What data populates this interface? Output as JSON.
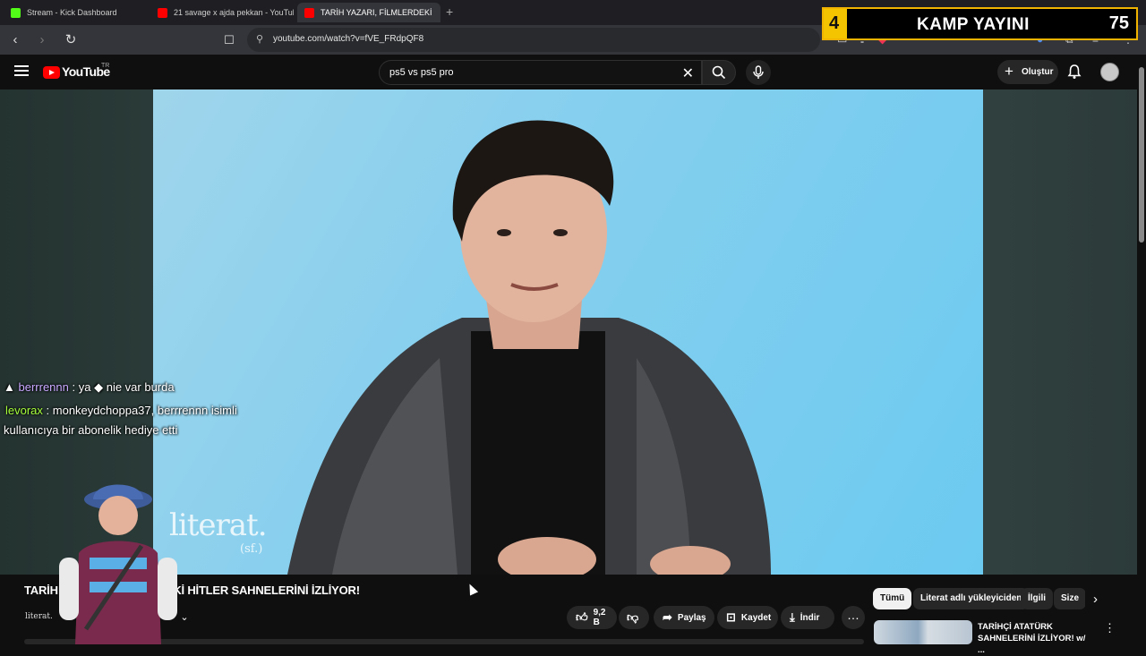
{
  "browser": {
    "tabs": [
      {
        "title": "Stream - Kick Dashboard",
        "favicon_color": "#53fc18"
      },
      {
        "title": "21 savage x ajda pekkan - YouTube",
        "favicon_color": "#ff0000"
      },
      {
        "title": "TARİH YAZARI, FİLMLERDEKİ",
        "favicon_color": "#ff0000",
        "active": true
      }
    ],
    "new_tab": "+",
    "url": "youtube.com/watch?v=fVE_FRdpQF8"
  },
  "overlay": {
    "number": "4",
    "title": "KAMP YAYINI",
    "count": "75"
  },
  "youtube": {
    "logo_text": "YouTube",
    "country": "TR",
    "search_value": "ps5 vs ps5 pro",
    "create_label": "Oluştur"
  },
  "video": {
    "watermark": "literat.",
    "watermark_sub": "(sf.)"
  },
  "chat": [
    {
      "user": "berrrennn",
      "text": ": ya",
      "text2": "nie var burda"
    },
    {
      "user": "levorax",
      "text": ": monkeydchoppa37, berrrennn isimli",
      "line2": "kullanıcıya bir abonelik hediye etti"
    }
  ],
  "watch": {
    "title": "TARİH YAZARI, FİLMLERDEKİ HİTLER SAHNELERİNİ İZLİYOR!",
    "channel_logo": "literat.",
    "likes": "9,2 B",
    "share": "Paylaş",
    "save": "Kaydet",
    "download": "İndir"
  },
  "chips": [
    "Tümü",
    "Literat adlı yükleyiciden",
    "İlgili",
    "Size"
  ],
  "recommendation": {
    "title": "TARİHÇİ ATATÜRK SAHNELERİNİ İZLİYOR! w/ ..."
  },
  "colors": {
    "yt_red": "#ff0000",
    "overlay_yellow": "#f4c400",
    "video_bg": "#86cfee"
  }
}
